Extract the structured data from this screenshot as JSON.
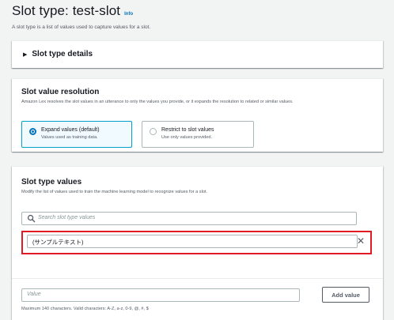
{
  "page": {
    "title": "Slot type: test-slot",
    "info_link": "Info",
    "description": "A slot type is a list of values used to capture values for a slot."
  },
  "details": {
    "label": "Slot type details",
    "expanded": false
  },
  "resolution": {
    "title": "Slot value resolution",
    "description": "Amazon Lex resolves the slot values in an utterance to only the values you provide, or it expands the resolution to related or similar values.",
    "options": [
      {
        "label": "Expand values (default)",
        "sub": "Values used as training data.",
        "selected": true
      },
      {
        "label": "Restrict to slot values",
        "sub": "Use only values provided.",
        "selected": false
      }
    ]
  },
  "values": {
    "title": "Slot type values",
    "description": "Modify the list of values used to train the machine learning model to recognize values for a slot.",
    "search_placeholder": "Search slot type values",
    "items": [
      {
        "value": "(サンプルテキスト)"
      }
    ],
    "new_value_placeholder": "Value",
    "add_button_label": "Add value",
    "constraint": "Maximum 140 characters. Valid characters: A-Z, a-z, 0-9, @, #, $"
  },
  "colors": {
    "accent": "#0073bb",
    "selected_border": "#00a1c9",
    "highlight": "#e01b24",
    "background": "#f2f3f3"
  }
}
